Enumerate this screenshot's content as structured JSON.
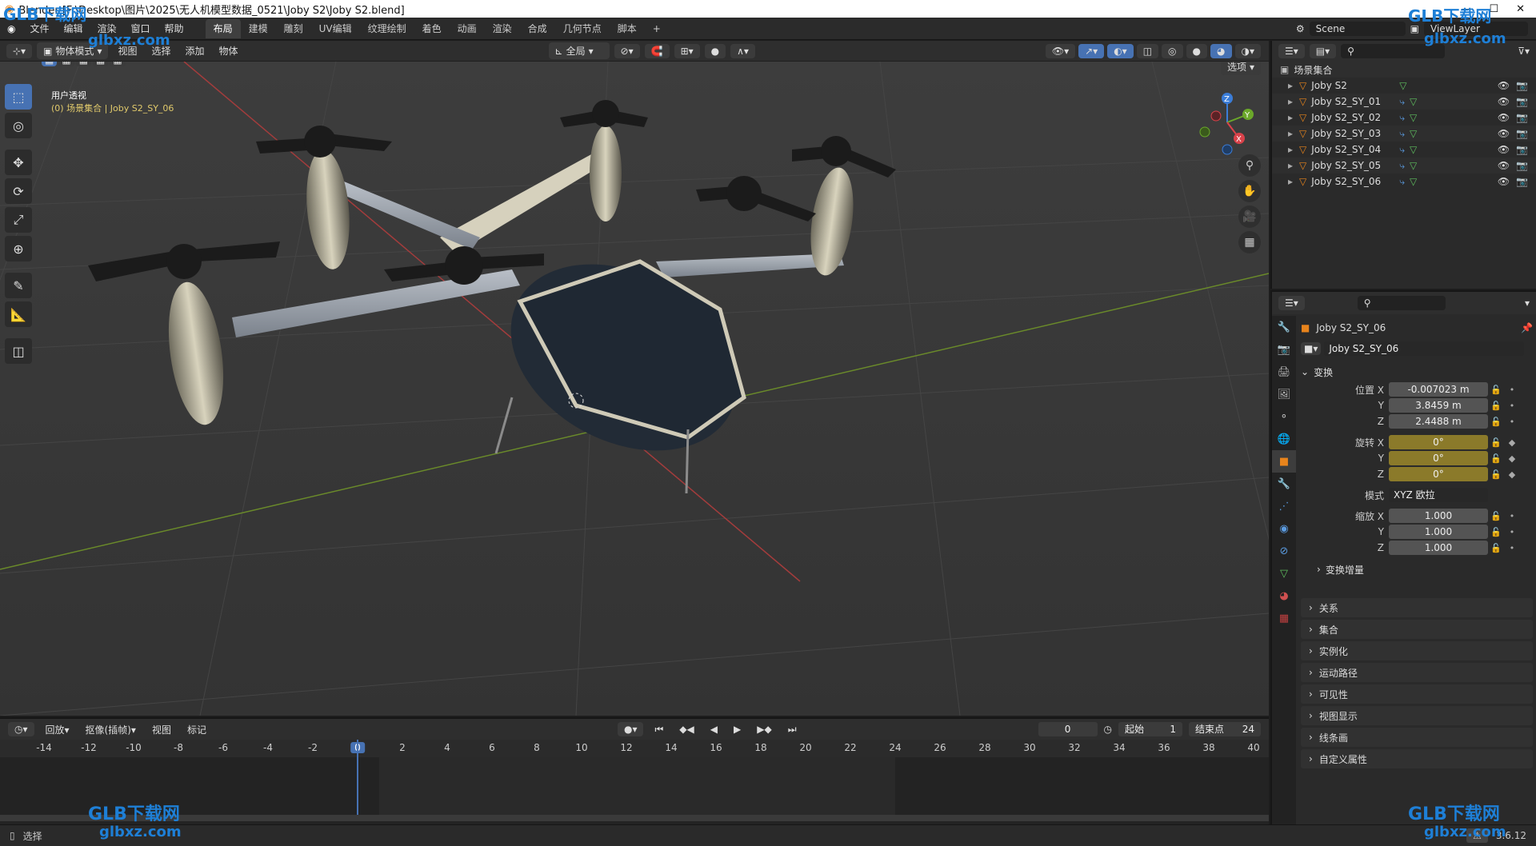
{
  "window": {
    "title": "Blender [F:\\Desktop\\图片\\2025\\无人机模型数据_0521\\Joby S2\\Joby S2.blend]"
  },
  "menu": [
    "文件",
    "编辑",
    "渲染",
    "窗口",
    "帮助"
  ],
  "workspaces": [
    "布局",
    "建模",
    "雕刻",
    "UV编辑",
    "纹理绘制",
    "着色",
    "动画",
    "渲染",
    "合成",
    "几何节点",
    "脚本"
  ],
  "active_workspace": "布局",
  "scene": {
    "name": "Scene",
    "view_layer": "ViewLayer"
  },
  "viewport_header": {
    "mode": "物体模式",
    "menus": [
      "视图",
      "选择",
      "添加",
      "物体"
    ],
    "transform_orientation": "全局",
    "options_label": "选项"
  },
  "viewport": {
    "view_name": "用户透视",
    "collection_info": "(0) 场景集合 | Joby S2_SY_06"
  },
  "gizmo": {
    "x": "X",
    "y": "Y",
    "z": "Z"
  },
  "outliner": {
    "root": "场景集合",
    "items": [
      "Joby S2",
      "Joby S2_SY_01",
      "Joby S2_SY_02",
      "Joby S2_SY_03",
      "Joby S2_SY_04",
      "Joby S2_SY_05",
      "Joby S2_SY_06"
    ]
  },
  "properties": {
    "object_name": "Joby S2_SY_06",
    "object_field": "Joby S2_SY_06",
    "transform_title": "变换",
    "location_label": "位置 X",
    "location": {
      "x": "-0.007023 m",
      "y": "3.8459 m",
      "z": "2.4488 m"
    },
    "rotation_label": "旋转 X",
    "rotation": {
      "x": "0°",
      "y": "0°",
      "z": "0°"
    },
    "mode_label": "模式",
    "mode_value": "XYZ 欧拉",
    "scale_label": "缩放 X",
    "scale": {
      "x": "1.000",
      "y": "1.000",
      "z": "1.000"
    },
    "axis_y": "Y",
    "axis_z": "Z",
    "delta_transform": "变换增量",
    "panels": [
      "关系",
      "集合",
      "实例化",
      "运动路径",
      "可见性",
      "视图显示",
      "线条画",
      "自定义属性"
    ]
  },
  "timeline": {
    "menus": [
      "回放",
      "抠像(插帧)",
      "视图",
      "标记"
    ],
    "current_frame": "0",
    "start_label": "起始",
    "start": "1",
    "end_label": "结束点",
    "end": "24",
    "ruler": [
      "-14",
      "-12",
      "-10",
      "-8",
      "-6",
      "-4",
      "-2",
      "0",
      "2",
      "4",
      "6",
      "8",
      "10",
      "12",
      "14",
      "16",
      "18",
      "20",
      "22",
      "24",
      "26",
      "28",
      "30",
      "32",
      "34",
      "36",
      "38",
      "40"
    ]
  },
  "status": {
    "left": "选择",
    "version": "3.6.12"
  },
  "watermark": {
    "brand": "GLB下载网",
    "url": "glbxz.com"
  },
  "colors": {
    "accent": "#4772b3",
    "animated_field": "#8b7a2a",
    "frame_indicator": "#4772b3"
  }
}
